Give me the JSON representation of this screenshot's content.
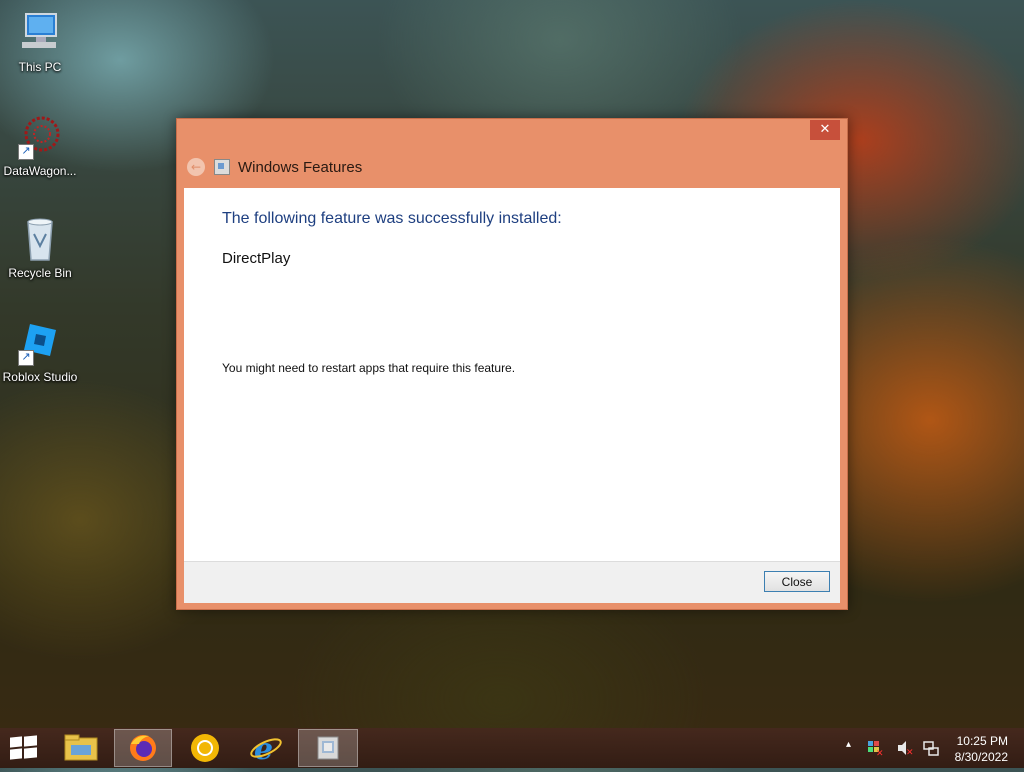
{
  "desktop": {
    "icons": [
      {
        "label": "This PC"
      },
      {
        "label": "DataWagon..."
      },
      {
        "label": "Recycle Bin"
      },
      {
        "label": "Roblox Studio"
      }
    ]
  },
  "dialog": {
    "title": "Windows Features",
    "close_glyph": "✕",
    "back_glyph": "←",
    "heading": "The following feature was successfully installed:",
    "feature_name": "DirectPlay",
    "note": "You might need to restart apps that require this feature.",
    "close_button": "Close",
    "accent_color": "#e8906a",
    "heading_color": "#1e3f80"
  },
  "taskbar": {
    "items": [
      "start-icon",
      "file-explorer-icon",
      "firefox-icon",
      "chrome-canary-icon",
      "internet-explorer-icon",
      "windows-features-icon"
    ],
    "active_item": "windows-features-icon"
  },
  "tray": {
    "time": "10:25 PM",
    "date": "8/30/2022",
    "chevron_glyph": "▴",
    "icons": [
      "show-hidden-icons-chevron",
      "action-center-icon",
      "volume-muted-icon",
      "network-icon"
    ]
  }
}
